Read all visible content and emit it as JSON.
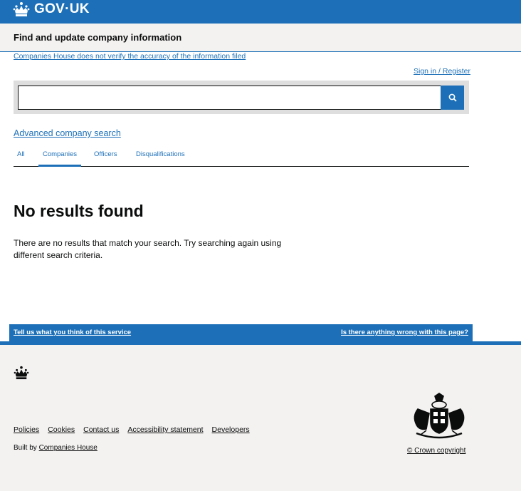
{
  "header": {
    "logotype": "GOV·UK"
  },
  "service": {
    "name": "Find and update company information"
  },
  "disclaimer": "Companies House does not verify the accuracy of the information filed",
  "signin": "Sign in / Register",
  "search": {
    "value": "",
    "placeholder": ""
  },
  "advanced_search": "Advanced company search",
  "tabs": [
    {
      "label": "All"
    },
    {
      "label": "Companies",
      "active": true
    },
    {
      "label": "Officers"
    },
    {
      "label": "Disqualifications"
    }
  ],
  "results": {
    "heading": "No results found",
    "message": "There are no results that match your search. Try searching again using different search criteria."
  },
  "feedback": {
    "left": "Tell us what you think of this service",
    "right": "Is there anything wrong with this page?"
  },
  "footer": {
    "links": [
      "Policies",
      "Cookies",
      "Contact us",
      "Accessibility statement",
      "Developers"
    ],
    "built_by_prefix": "Built by",
    "built_by_link": "Companies House",
    "copyright": "© Crown copyright"
  },
  "colors": {
    "brand": "#1d70b8",
    "text": "#0b0c0c",
    "footer_bg": "#f3f2f1",
    "search_bg": "#dedede"
  },
  "icons": [
    "crown-icon",
    "search-icon",
    "royal-coat-of-arms"
  ]
}
